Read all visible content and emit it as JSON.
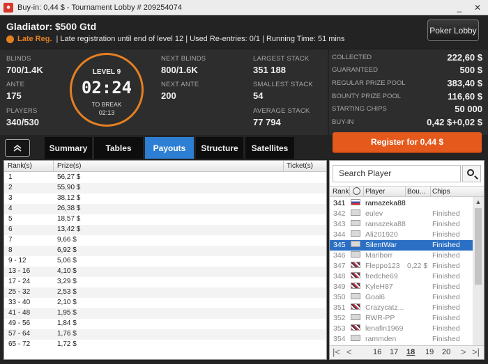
{
  "titlebar": {
    "title": "Buy-in: 0,44 $ - Tournament Lobby # 209254074",
    "icon": "poker-spade-icon",
    "minimize": "_",
    "close": "✕"
  },
  "header": {
    "title": "Gladiator: $500 Gtd",
    "late_reg_label": "Late Reg.",
    "late_reg_info": "| Late registration until end of level 12 | Used Re-entries: 0/1 | Running Time: 51 mins",
    "lobby_button": "Poker Lobby"
  },
  "info": {
    "blinds_label": "BLINDS",
    "blinds": "700/1.4K",
    "ante_label": "ANTE",
    "ante": "175",
    "players_label": "PLAYERS",
    "players": "340/530",
    "next_blinds_label": "NEXT BLINDS",
    "next_blinds": "800/1.6K",
    "next_ante_label": "NEXT ANTE",
    "next_ante": "200",
    "largest_label": "LARGEST STACK",
    "largest": "351 188",
    "smallest_label": "SMALLEST STACK",
    "smallest": "54",
    "average_label": "AVERAGE STACK",
    "average": "77 794"
  },
  "clock": {
    "level": "LEVEL 9",
    "time": "02:24",
    "to_break_label": "TO BREAK",
    "break_time": "02:13",
    "accent": "#e58021"
  },
  "prize": [
    {
      "label": "COLLECTED",
      "value": "222,60 $"
    },
    {
      "label": "GUARANTEED",
      "value": "500 $"
    },
    {
      "label": "REGULAR PRIZE POOL",
      "value": "383,40 $"
    },
    {
      "label": "BOUNTY PRIZE POOL",
      "value": "116,60 $"
    },
    {
      "label": "STARTING CHIPS",
      "value": "50 000"
    },
    {
      "label": "BUY-IN",
      "value": "0,42 $+0,02 $"
    }
  ],
  "collapse_icon": "chevron-up-double-icon",
  "tabs": [
    {
      "label": "Summary",
      "active": false
    },
    {
      "label": "Tables",
      "active": false
    },
    {
      "label": "Payouts",
      "active": true
    },
    {
      "label": "Structure",
      "active": false
    },
    {
      "label": "Satellites",
      "active": false
    }
  ],
  "register_button": "Register for  0,44 $",
  "payouts": {
    "headers": {
      "rank": "Rank(s)",
      "prize": "Prize(s)",
      "ticket": "Ticket(s)"
    },
    "rows": [
      {
        "rank": "1",
        "prize": "56,27 $"
      },
      {
        "rank": "2",
        "prize": "55,90 $"
      },
      {
        "rank": "3",
        "prize": "38,12 $"
      },
      {
        "rank": "4",
        "prize": "26,38 $"
      },
      {
        "rank": "5",
        "prize": "18,57 $"
      },
      {
        "rank": "6",
        "prize": "13,42 $"
      },
      {
        "rank": "7",
        "prize": "9,66 $"
      },
      {
        "rank": "8",
        "prize": "6,92 $"
      },
      {
        "rank": "9 - 12",
        "prize": "5,06 $"
      },
      {
        "rank": "13 - 16",
        "prize": "4,10 $"
      },
      {
        "rank": "17 - 24",
        "prize": "3,29 $"
      },
      {
        "rank": "25 - 32",
        "prize": "2,53 $"
      },
      {
        "rank": "33 - 40",
        "prize": "2,10 $"
      },
      {
        "rank": "41 - 48",
        "prize": "1,95 $"
      },
      {
        "rank": "49 - 56",
        "prize": "1,84 $"
      },
      {
        "rank": "57 - 64",
        "prize": "1,76 $"
      },
      {
        "rank": "65 - 72",
        "prize": "1,72 $"
      }
    ]
  },
  "players_list": {
    "search_placeholder": "Search Player",
    "headers": {
      "rank": "Rank",
      "player": "Player",
      "bounty": "Bou...",
      "chips": "Chips"
    },
    "rows": [
      {
        "rank": "341",
        "flag": "ru",
        "player": "ramazeka88",
        "bounty": "",
        "chips": ""
      },
      {
        "rank": "342",
        "flag": "gen",
        "player": "eulev",
        "bounty": "",
        "chips": "Finished"
      },
      {
        "rank": "343",
        "flag": "gen",
        "player": "ramazeka88",
        "bounty": "",
        "chips": "Finished"
      },
      {
        "rank": "344",
        "flag": "gen",
        "player": "Ali201920",
        "bounty": "",
        "chips": "Finished"
      },
      {
        "rank": "345",
        "flag": "gen",
        "player": "SilentWar",
        "bounty": "",
        "chips": "Finished"
      },
      {
        "rank": "346",
        "flag": "gen",
        "player": "Mariborr",
        "bounty": "",
        "chips": "Finished"
      },
      {
        "rank": "347",
        "flag": "uk",
        "player": "Fleppo123",
        "bounty": "0,22 $",
        "chips": "Finished"
      },
      {
        "rank": "348",
        "flag": "uk",
        "player": "fredche69",
        "bounty": "",
        "chips": "Finished"
      },
      {
        "rank": "349",
        "flag": "uk",
        "player": "KyleH87",
        "bounty": "",
        "chips": "Finished"
      },
      {
        "rank": "350",
        "flag": "gen",
        "player": "Goal6",
        "bounty": "",
        "chips": "Finished"
      },
      {
        "rank": "351",
        "flag": "uk",
        "player": "Crazycatz...",
        "bounty": "",
        "chips": "Finished"
      },
      {
        "rank": "352",
        "flag": "gen",
        "player": "RWR-PP",
        "bounty": "",
        "chips": "Finished"
      },
      {
        "rank": "353",
        "flag": "uk",
        "player": "lenafin1969",
        "bounty": "",
        "chips": "Finished"
      },
      {
        "rank": "354",
        "flag": "gen",
        "player": "rammden",
        "bounty": "",
        "chips": "Finished"
      }
    ],
    "selected_rank": "345",
    "pages": [
      "16",
      "17",
      "18",
      "19",
      "20"
    ],
    "current_page": "18"
  }
}
